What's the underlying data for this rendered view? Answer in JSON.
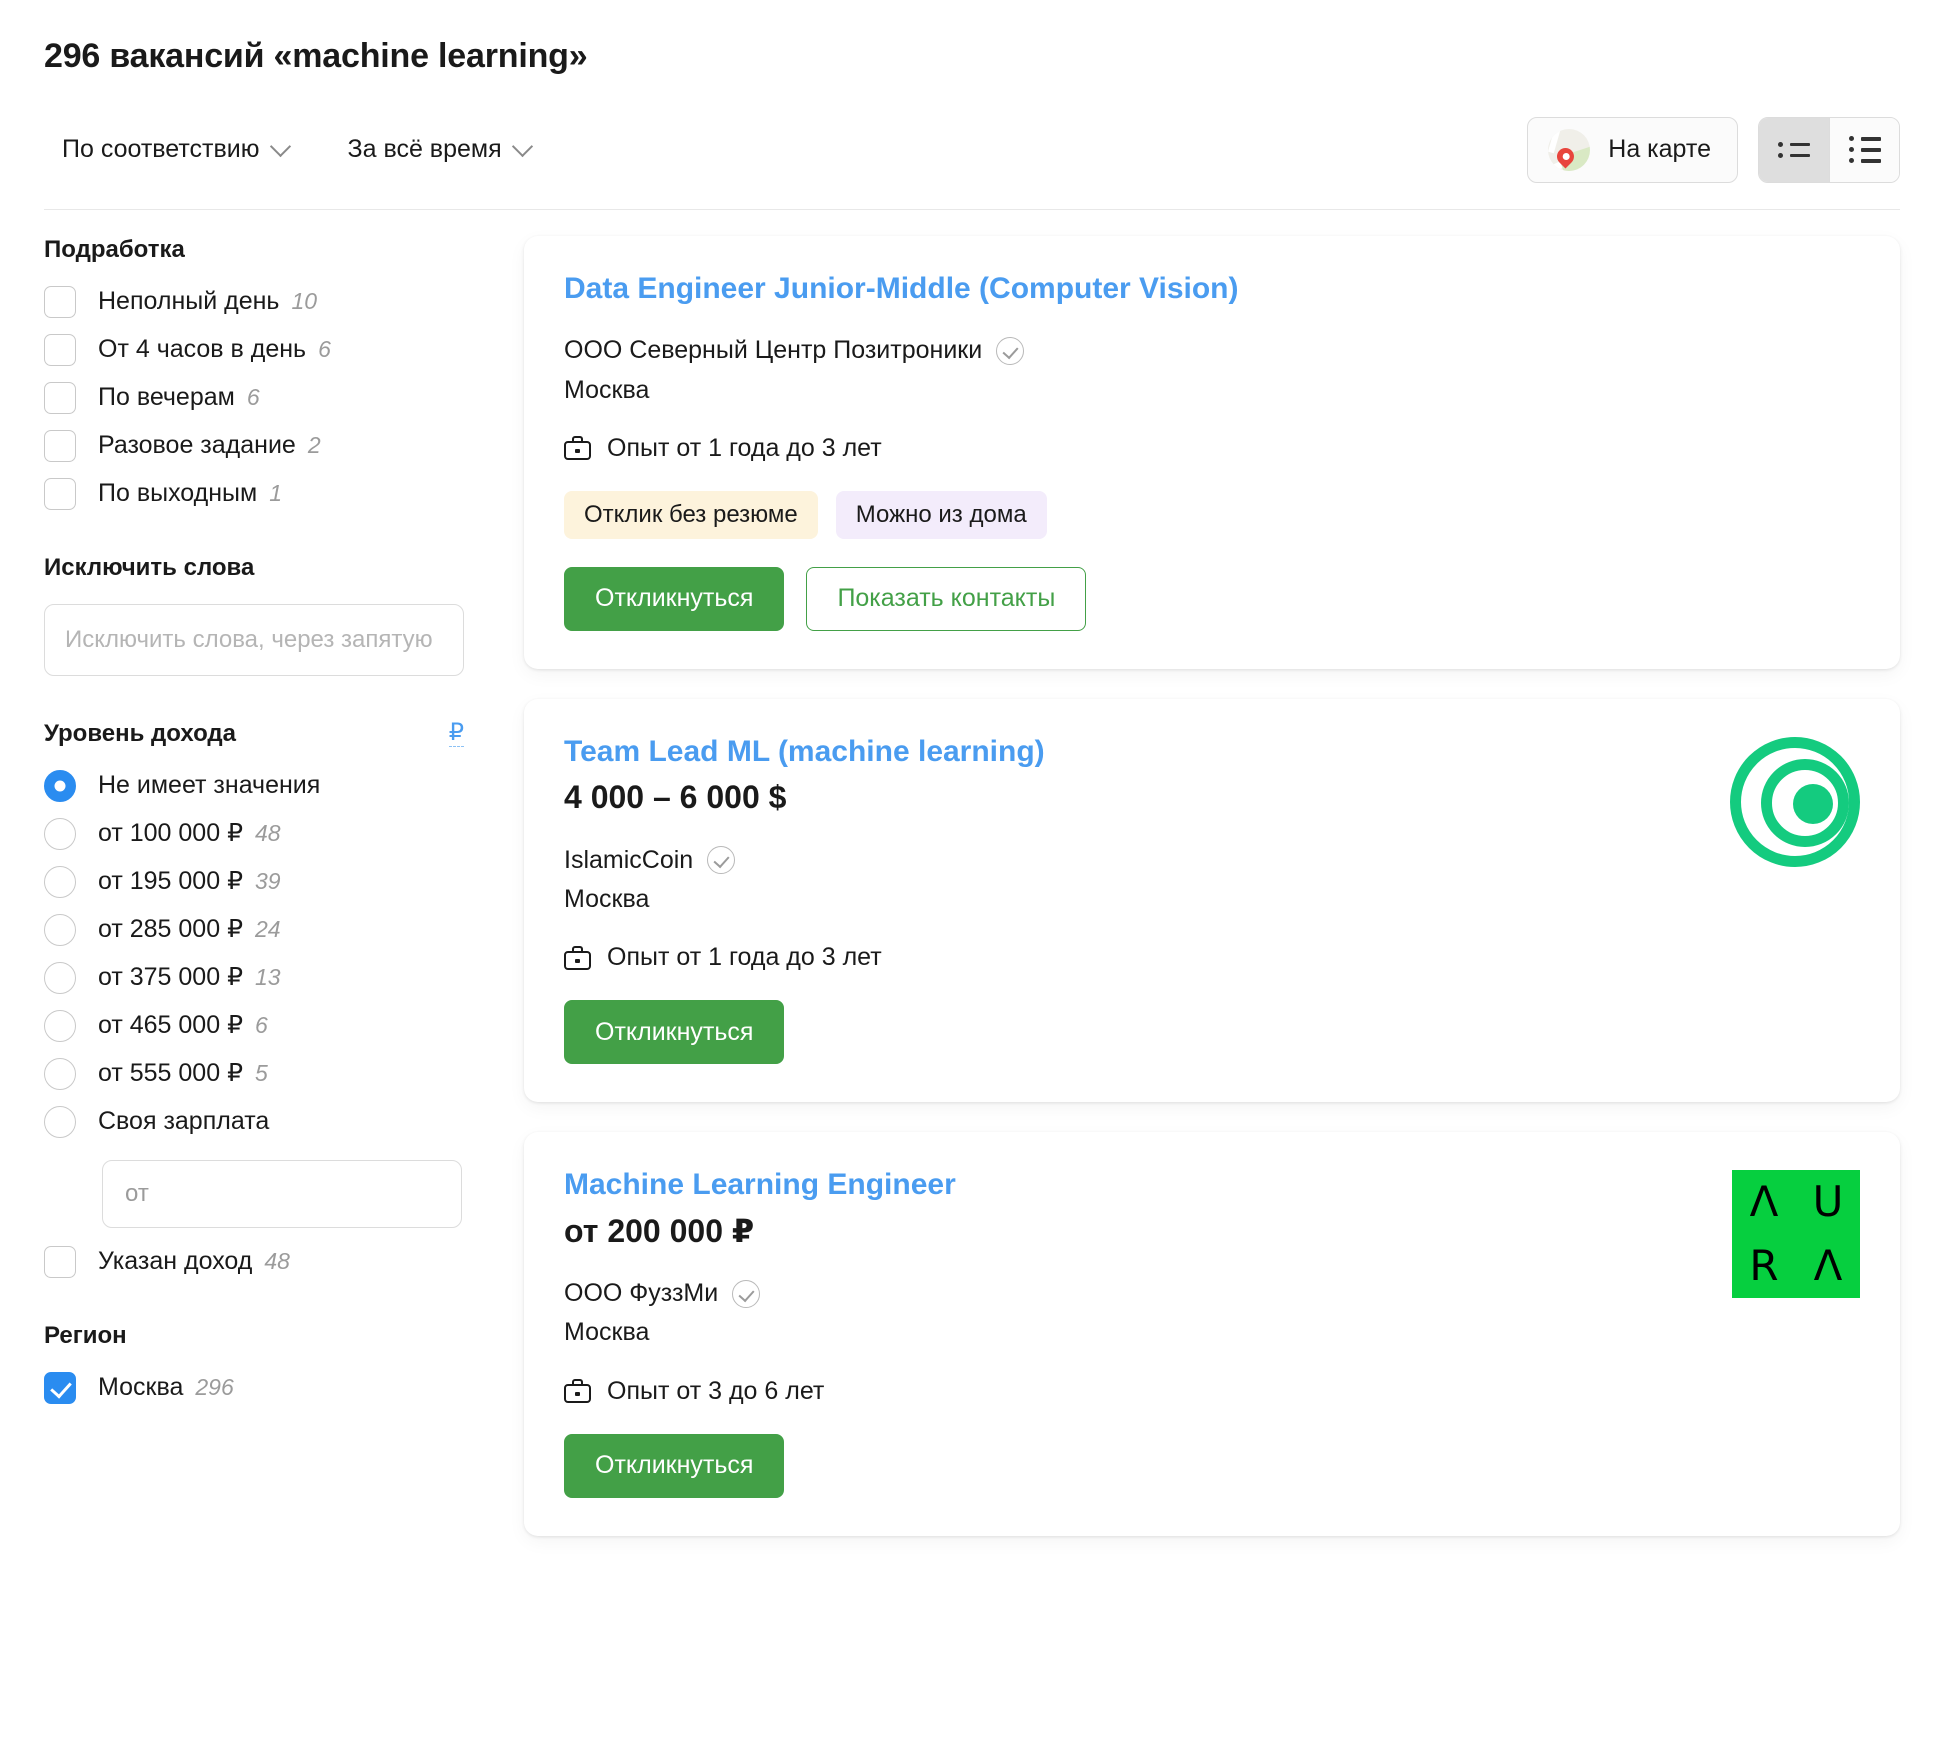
{
  "header": {
    "title": "296 вакансий «machine learning»",
    "sort_label": "По соответствию",
    "period_label": "За всё время",
    "map_button_label": "На карте"
  },
  "sidebar": {
    "parttime": {
      "title": "Подработка",
      "options": [
        {
          "label": "Неполный день",
          "count": "10"
        },
        {
          "label": "От 4 часов в день",
          "count": "6"
        },
        {
          "label": "По вечерам",
          "count": "6"
        },
        {
          "label": "Разовое задание",
          "count": "2"
        },
        {
          "label": "По выходным",
          "count": "1"
        }
      ]
    },
    "exclude": {
      "title": "Исключить слова",
      "placeholder": "Исключить слова, через запятую",
      "value": ""
    },
    "income": {
      "title": "Уровень дохода",
      "currency_symbol": "₽",
      "options": [
        {
          "label": "Не имеет значения",
          "count": "",
          "selected": true
        },
        {
          "label": "от 100 000 ₽",
          "count": "48",
          "selected": false
        },
        {
          "label": "от 195 000 ₽",
          "count": "39",
          "selected": false
        },
        {
          "label": "от 285 000 ₽",
          "count": "24",
          "selected": false
        },
        {
          "label": "от 375 000 ₽",
          "count": "13",
          "selected": false
        },
        {
          "label": "от 465 000 ₽",
          "count": "6",
          "selected": false
        },
        {
          "label": "от 555 000 ₽",
          "count": "5",
          "selected": false
        },
        {
          "label": "Своя зарплата",
          "count": "",
          "selected": false
        }
      ],
      "own_salary_placeholder": "от",
      "own_salary_value": "",
      "specified_label": "Указан доход",
      "specified_count": "48"
    },
    "region": {
      "title": "Регион",
      "option_label": "Москва",
      "option_count": "296"
    }
  },
  "jobs": [
    {
      "title": "Data Engineer Junior-Middle (Computer Vision)",
      "salary": "",
      "company": "ООО Северный Центр Позитроники",
      "city": "Москва",
      "experience": "Опыт от 1 года до 3 лет",
      "tags": [
        "Отклик без резюме",
        "Можно из дома"
      ],
      "primary_action": "Откликнуться",
      "secondary_action": "Показать контакты",
      "logo": ""
    },
    {
      "title": "Team Lead ML (machine learning)",
      "salary": "4 000 – 6 000 $",
      "company": "IslamicCoin",
      "city": "Москва",
      "experience": "Опыт от 1 года до 3 лет",
      "tags": [],
      "primary_action": "Откликнуться",
      "secondary_action": "",
      "logo": "islamiccoin-logo"
    },
    {
      "title": "Machine Learning Engineer",
      "salary": "от 200 000 ₽",
      "company": "ООО ФуззМи",
      "city": "Москва",
      "experience": "Опыт от 3 до 6 лет",
      "tags": [],
      "primary_action": "Откликнуться",
      "secondary_action": "",
      "logo": "aura-logo"
    }
  ],
  "aura_logo_letters": [
    "Λ",
    "U",
    "R",
    "Λ"
  ],
  "colors": {
    "link": "#4a9cf0",
    "primary_button": "#43a047",
    "accent_checkbox": "#2a8cf0",
    "aura_green": "#06cf3f",
    "coin_green": "#14cb7f"
  }
}
